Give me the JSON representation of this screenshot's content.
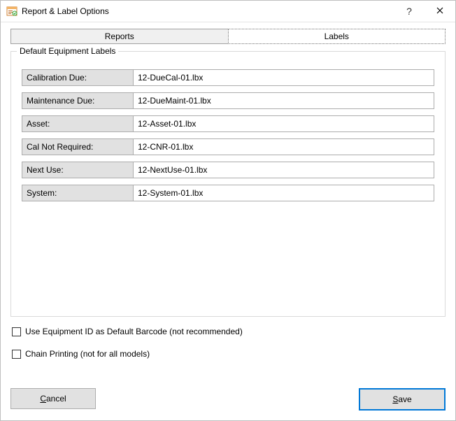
{
  "window": {
    "title": "Report & Label Options"
  },
  "tabs": [
    {
      "label": "Reports",
      "active": false
    },
    {
      "label": "Labels",
      "active": true
    }
  ],
  "group": {
    "title": "Default Equipment Labels",
    "rows": [
      {
        "label": "Calibration Due:",
        "value": "12-DueCal-01.lbx"
      },
      {
        "label": "Maintenance Due:",
        "value": "12-DueMaint-01.lbx"
      },
      {
        "label": "Asset:",
        "value": "12-Asset-01.lbx"
      },
      {
        "label": "Cal Not Required:",
        "value": "12-CNR-01.lbx"
      },
      {
        "label": "Next Use:",
        "value": "12-NextUse-01.lbx"
      },
      {
        "label": "System:",
        "value": "12-System-01.lbx"
      }
    ]
  },
  "checkboxes": [
    {
      "label": "Use Equipment ID as Default Barcode (not recommended)",
      "checked": false
    },
    {
      "label": "Chain Printing (not for all models)",
      "checked": false
    }
  ],
  "buttons": {
    "cancel": {
      "accel": "C",
      "rest": "ancel"
    },
    "save": {
      "accel": "S",
      "rest": "ave"
    }
  }
}
